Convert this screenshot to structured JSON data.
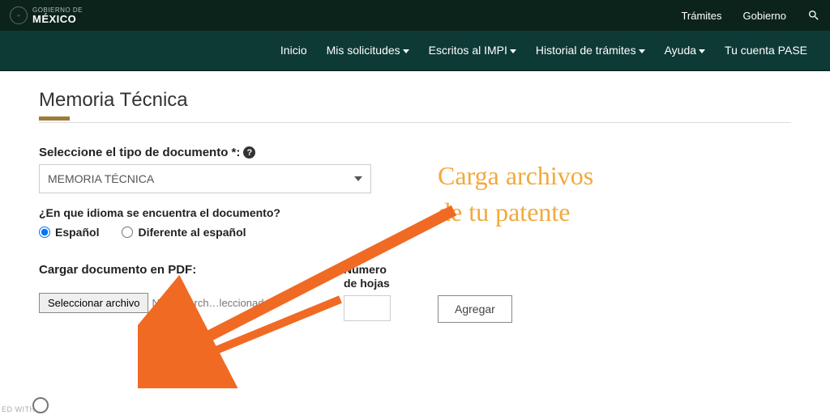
{
  "header": {
    "brand_line1": "GOBIERNO DE",
    "brand_line2": "MÉXICO",
    "links": {
      "tramites": "Trámites",
      "gobierno": "Gobierno"
    }
  },
  "nav": {
    "inicio": "Inicio",
    "solicitudes": "Mis solicitudes",
    "escritos": "Escritos al IMPI",
    "historial": "Historial de trámites",
    "ayuda": "Ayuda",
    "cuenta": "Tu cuenta PASE"
  },
  "page": {
    "title": "Memoria Técnica",
    "tipo_label": "Seleccione el tipo de documento *:",
    "tipo_value": "MEMORIA TÉCNICA",
    "idioma_label": "¿En que idioma se encuentra el documento?",
    "radio_es": "Español",
    "radio_diff": "Diferente al español",
    "cargar_label": "Cargar documento en PDF:",
    "file_button": "Seleccionar archivo",
    "file_status": "Ningún arch…leccionado",
    "num_hojas_label": "Número de hojas",
    "agregar": "Agregar"
  },
  "annotation": {
    "line1": "Carga archivos",
    "line2": "de tu patente"
  },
  "watermark": "ED WITH"
}
